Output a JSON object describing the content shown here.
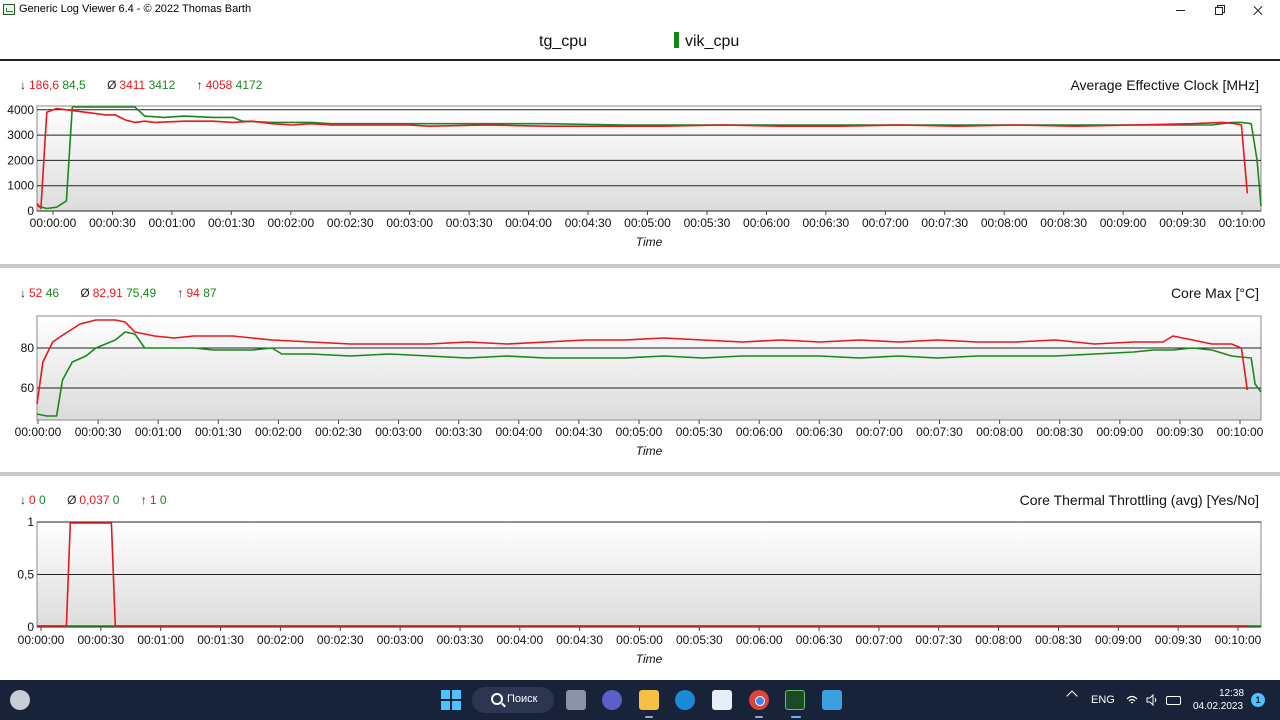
{
  "window": {
    "title": "Generic Log Viewer 6.4 - © 2022 Thomas Barth"
  },
  "legend": {
    "items": [
      {
        "label": "tg_cpu",
        "color": "#e8171e"
      },
      {
        "label": "vik_cpu",
        "color": "#19881e"
      }
    ]
  },
  "colors": {
    "red": "#e8171e",
    "green": "#19881e",
    "plot_bg_top": "#ffffff",
    "plot_bg_bottom": "#dcdcdc"
  },
  "time_ticks": [
    "00:00:00",
    "00:00:30",
    "00:01:00",
    "00:01:30",
    "00:02:00",
    "00:02:30",
    "00:03:00",
    "00:03:30",
    "00:04:00",
    "00:04:30",
    "00:05:00",
    "00:05:30",
    "00:06:00",
    "00:06:30",
    "00:07:00",
    "00:07:30",
    "00:08:00",
    "00:08:30",
    "00:09:00",
    "00:09:30",
    "00:10:00"
  ],
  "panels": [
    {
      "title": "Average Effective Clock [MHz]",
      "stats": {
        "min_sym": "↓",
        "min_red": "186,6",
        "min_green": "84,5",
        "avg_sym": "Ø",
        "avg_red": "3411",
        "avg_green": "3412",
        "max_sym": "↑",
        "max_red": "4058",
        "max_green": "4172"
      }
    },
    {
      "title": "Core Max [°C]",
      "stats": {
        "min_sym": "↓",
        "min_red": "52",
        "min_green": "46",
        "avg_sym": "Ø",
        "avg_red": "82,91",
        "avg_green": "75,49",
        "max_sym": "↑",
        "max_red": "94",
        "max_green": "87"
      }
    },
    {
      "title": "Core Thermal Throttling (avg) [Yes/No]",
      "stats": {
        "min_sym": "↓",
        "min_red": "0",
        "min_green": "0",
        "avg_sym": "Ø",
        "avg_red": "0,037",
        "avg_green": "0",
        "max_sym": "↑",
        "max_red": "1",
        "max_green": "0"
      }
    }
  ],
  "chart_data": [
    {
      "type": "line",
      "title": "Average Effective Clock [MHz]",
      "xlabel": "Time",
      "ylabel": "",
      "x_unit": "seconds",
      "xlim": [
        0,
        625
      ],
      "ylim": [
        0,
        4000
      ],
      "ymax_visible": 4150,
      "yticks": [
        0,
        1000,
        2000,
        3000,
        4000
      ],
      "ytick_labels": [
        "0",
        "1000",
        "2000",
        "3000",
        "4000"
      ],
      "grid": true,
      "series": [
        {
          "name": "tg_cpu",
          "color": "#e8171e",
          "points": [
            [
              0,
              300
            ],
            [
              2,
              100
            ],
            [
              5,
              3900
            ],
            [
              10,
              4050
            ],
            [
              15,
              4000
            ],
            [
              20,
              3950
            ],
            [
              25,
              3900
            ],
            [
              30,
              3850
            ],
            [
              35,
              3800
            ],
            [
              40,
              3800
            ],
            [
              45,
              3600
            ],
            [
              50,
              3500
            ],
            [
              55,
              3550
            ],
            [
              60,
              3500
            ],
            [
              75,
              3550
            ],
            [
              90,
              3550
            ],
            [
              100,
              3500
            ],
            [
              110,
              3550
            ],
            [
              120,
              3450
            ],
            [
              130,
              3400
            ],
            [
              140,
              3450
            ],
            [
              150,
              3400
            ],
            [
              170,
              3400
            ],
            [
              190,
              3400
            ],
            [
              200,
              3350
            ],
            [
              230,
              3400
            ],
            [
              260,
              3350
            ],
            [
              290,
              3350
            ],
            [
              320,
              3350
            ],
            [
              350,
              3400
            ],
            [
              380,
              3350
            ],
            [
              410,
              3350
            ],
            [
              440,
              3400
            ],
            [
              470,
              3350
            ],
            [
              500,
              3400
            ],
            [
              530,
              3350
            ],
            [
              560,
              3400
            ],
            [
              590,
              3450
            ],
            [
              605,
              3500
            ],
            [
              612,
              3450
            ],
            [
              615,
              3400
            ],
            [
              618,
              700
            ]
          ]
        },
        {
          "name": "vik_cpu",
          "color": "#19881e",
          "points": [
            [
              0,
              200
            ],
            [
              5,
              100
            ],
            [
              10,
              150
            ],
            [
              15,
              400
            ],
            [
              18,
              4150
            ],
            [
              25,
              4150
            ],
            [
              40,
              4150
            ],
            [
              50,
              4150
            ],
            [
              55,
              3750
            ],
            [
              65,
              3700
            ],
            [
              75,
              3750
            ],
            [
              90,
              3700
            ],
            [
              100,
              3700
            ],
            [
              105,
              3550
            ],
            [
              120,
              3500
            ],
            [
              140,
              3500
            ],
            [
              150,
              3450
            ],
            [
              170,
              3450
            ],
            [
              190,
              3450
            ],
            [
              230,
              3450
            ],
            [
              260,
              3450
            ],
            [
              300,
              3400
            ],
            [
              340,
              3400
            ],
            [
              380,
              3400
            ],
            [
              420,
              3400
            ],
            [
              460,
              3400
            ],
            [
              500,
              3400
            ],
            [
              540,
              3400
            ],
            [
              570,
              3400
            ],
            [
              600,
              3400
            ],
            [
              610,
              3500
            ],
            [
              615,
              3500
            ],
            [
              620,
              3450
            ],
            [
              623,
              2000
            ],
            [
              625,
              200
            ]
          ]
        }
      ]
    },
    {
      "type": "line",
      "title": "Core Max [°C]",
      "xlabel": "Time",
      "ylabel": "",
      "x_unit": "seconds",
      "xlim": [
        0,
        625
      ],
      "ylim": [
        44,
        96
      ],
      "yticks": [
        60,
        80
      ],
      "ytick_labels": [
        "60",
        "80"
      ],
      "grid": true,
      "series": [
        {
          "name": "tg_cpu",
          "color": "#e8171e",
          "points": [
            [
              0,
              52
            ],
            [
              3,
              73
            ],
            [
              8,
              83
            ],
            [
              14,
              87
            ],
            [
              22,
              92
            ],
            [
              30,
              94
            ],
            [
              40,
              94
            ],
            [
              45,
              93
            ],
            [
              50,
              88
            ],
            [
              60,
              86
            ],
            [
              70,
              85
            ],
            [
              80,
              86
            ],
            [
              90,
              86
            ],
            [
              100,
              86
            ],
            [
              110,
              85
            ],
            [
              120,
              84
            ],
            [
              140,
              83
            ],
            [
              160,
              82
            ],
            [
              180,
              82
            ],
            [
              200,
              82
            ],
            [
              220,
              83
            ],
            [
              240,
              82
            ],
            [
              260,
              83
            ],
            [
              280,
              84
            ],
            [
              300,
              84
            ],
            [
              320,
              85
            ],
            [
              340,
              84
            ],
            [
              360,
              83
            ],
            [
              380,
              84
            ],
            [
              400,
              83
            ],
            [
              420,
              84
            ],
            [
              440,
              83
            ],
            [
              460,
              84
            ],
            [
              480,
              83
            ],
            [
              500,
              83
            ],
            [
              520,
              84
            ],
            [
              540,
              82
            ],
            [
              560,
              83
            ],
            [
              575,
              83
            ],
            [
              580,
              86
            ],
            [
              590,
              84
            ],
            [
              600,
              82
            ],
            [
              610,
              82
            ],
            [
              615,
              80
            ],
            [
              618,
              59
            ]
          ]
        },
        {
          "name": "vik_cpu",
          "color": "#19881e",
          "points": [
            [
              0,
              47
            ],
            [
              5,
              46
            ],
            [
              10,
              46
            ],
            [
              13,
              64
            ],
            [
              18,
              73
            ],
            [
              25,
              76
            ],
            [
              30,
              80
            ],
            [
              40,
              84
            ],
            [
              45,
              88
            ],
            [
              50,
              87
            ],
            [
              55,
              80
            ],
            [
              60,
              80
            ],
            [
              80,
              80
            ],
            [
              90,
              79
            ],
            [
              100,
              79
            ],
            [
              110,
              79
            ],
            [
              120,
              80
            ],
            [
              125,
              77
            ],
            [
              140,
              77
            ],
            [
              160,
              76
            ],
            [
              180,
              77
            ],
            [
              200,
              76
            ],
            [
              220,
              75
            ],
            [
              240,
              76
            ],
            [
              260,
              75
            ],
            [
              280,
              75
            ],
            [
              300,
              75
            ],
            [
              320,
              76
            ],
            [
              340,
              75
            ],
            [
              360,
              76
            ],
            [
              380,
              76
            ],
            [
              400,
              76
            ],
            [
              420,
              75
            ],
            [
              440,
              76
            ],
            [
              460,
              75
            ],
            [
              480,
              76
            ],
            [
              500,
              76
            ],
            [
              520,
              76
            ],
            [
              540,
              77
            ],
            [
              560,
              78
            ],
            [
              570,
              79
            ],
            [
              580,
              79
            ],
            [
              590,
              80
            ],
            [
              600,
              79
            ],
            [
              610,
              76
            ],
            [
              620,
              75
            ],
            [
              622,
              62
            ],
            [
              625,
              58
            ]
          ]
        }
      ]
    },
    {
      "type": "line",
      "title": "Core Thermal Throttling (avg) [Yes/No]",
      "xlabel": "Time",
      "ylabel": "",
      "x_unit": "seconds",
      "xlim": [
        0,
        625
      ],
      "ylim": [
        0,
        1
      ],
      "yticks": [
        0,
        0.5,
        1
      ],
      "ytick_labels": [
        "0",
        "0,5",
        "1"
      ],
      "grid": true,
      "series": [
        {
          "name": "tg_cpu",
          "color": "#e8171e",
          "points": [
            [
              0,
              0
            ],
            [
              15,
              0
            ],
            [
              17,
              1
            ],
            [
              38,
              1
            ],
            [
              40,
              0
            ],
            [
              618,
              0
            ]
          ]
        },
        {
          "name": "vik_cpu",
          "color": "#19881e",
          "points": [
            [
              0,
              0
            ],
            [
              625,
              0
            ]
          ]
        }
      ]
    }
  ],
  "taskbar": {
    "search_label": "Поиск",
    "lang": "ENG",
    "time": "12:38",
    "date": "04.02.2023",
    "notification_count": "1",
    "icons": [
      "weather-icon",
      "start-icon",
      "search-icon",
      "task-view-icon",
      "chat-icon",
      "file-explorer-icon",
      "edge-icon",
      "store-icon",
      "chrome-icon",
      "log-viewer-icon",
      "photos-icon"
    ]
  }
}
